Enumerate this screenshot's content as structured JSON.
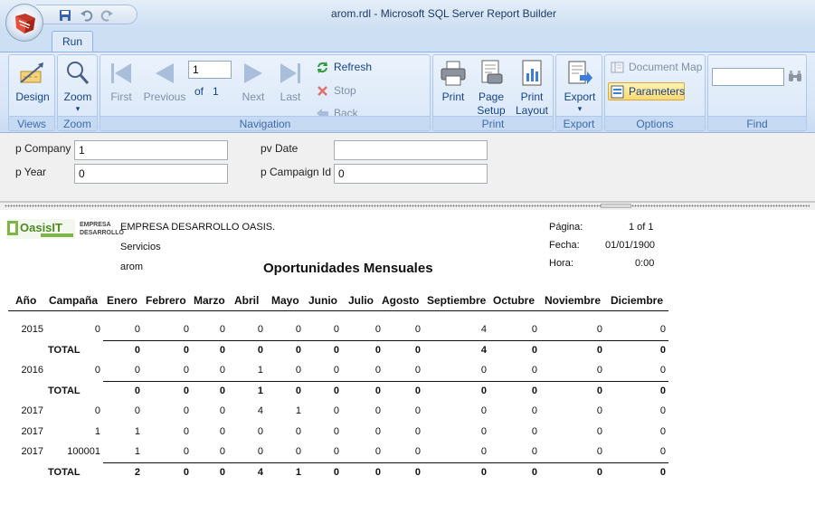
{
  "window": {
    "title": "arom.rdl - Microsoft SQL Server Report Builder"
  },
  "tabs": [
    {
      "label": "Run"
    }
  ],
  "ribbon": {
    "views": {
      "design_label": "Design",
      "group_label": "Views"
    },
    "zoom": {
      "zoom_label": "Zoom",
      "group_label": "Zoom"
    },
    "navigation": {
      "first_label": "First",
      "previous_label": "Previous",
      "page_value": "1",
      "of_label": "of",
      "total_pages": "1",
      "next_label": "Next",
      "last_label": "Last",
      "refresh_label": "Refresh",
      "stop_label": "Stop",
      "back_label": "Back",
      "group_label": "Navigation"
    },
    "print": {
      "print_label": "Print",
      "page_setup_label": "Page Setup",
      "print_layout_label": "Print Layout",
      "group_label": "Print"
    },
    "export": {
      "export_label": "Export",
      "group_label": "Export"
    },
    "options": {
      "document_map_label": "Document Map",
      "parameters_label": "Parameters",
      "group_label": "Options"
    },
    "find": {
      "search_value": "",
      "group_label": "Find"
    }
  },
  "parameters": {
    "p_company": {
      "label": "p Company",
      "value": "1"
    },
    "p_year": {
      "label": "p Year",
      "value": "0"
    },
    "pv_date": {
      "label": "pv Date",
      "value": ""
    },
    "p_campaign_id": {
      "label": "p Campaign Id",
      "value": "0"
    }
  },
  "report": {
    "logo_text": "OasisIT",
    "logo_sub": "EMPRESA DESARROLLO",
    "company": "EMPRESA DESARROLLO OASIS.",
    "department": "Servicios",
    "user": "arom",
    "title": "Oportunidades Mensuales",
    "meta": {
      "page_label": "Página:",
      "page_value": "1 of 1",
      "date_label": "Fecha:",
      "date_value": "01/01/1900",
      "time_label": "Hora:",
      "time_value": "0:00"
    },
    "columns": [
      "Año",
      "Campaña",
      "Enero",
      "Febrero",
      "Marzo",
      "Abril",
      "Mayo",
      "Junio",
      "Julio",
      "Agosto",
      "Septiembre",
      "Octubre",
      "Noviembre",
      "Diciembre"
    ],
    "rows": [
      {
        "type": "data",
        "cells": [
          "2015",
          "0",
          "0",
          "0",
          "0",
          "0",
          "0",
          "0",
          "0",
          "0",
          "4",
          "0",
          "0",
          "0"
        ]
      },
      {
        "type": "total",
        "cells": [
          "",
          "TOTAL",
          "0",
          "0",
          "0",
          "0",
          "0",
          "0",
          "0",
          "0",
          "4",
          "0",
          "0",
          "0"
        ]
      },
      {
        "type": "data",
        "cells": [
          "2016",
          "0",
          "0",
          "0",
          "0",
          "1",
          "0",
          "0",
          "0",
          "0",
          "0",
          "0",
          "0",
          "0"
        ]
      },
      {
        "type": "total",
        "cells": [
          "",
          "TOTAL",
          "0",
          "0",
          "0",
          "1",
          "0",
          "0",
          "0",
          "0",
          "0",
          "0",
          "0",
          "0"
        ]
      },
      {
        "type": "data",
        "cells": [
          "2017",
          "0",
          "0",
          "0",
          "0",
          "4",
          "1",
          "0",
          "0",
          "0",
          "0",
          "0",
          "0",
          "0"
        ]
      },
      {
        "type": "data",
        "cells": [
          "2017",
          "1",
          "1",
          "0",
          "0",
          "0",
          "0",
          "0",
          "0",
          "0",
          "0",
          "0",
          "0",
          "0"
        ]
      },
      {
        "type": "data",
        "cells": [
          "2017",
          "100001",
          "1",
          "0",
          "0",
          "0",
          "0",
          "0",
          "0",
          "0",
          "0",
          "0",
          "0",
          "0"
        ]
      },
      {
        "type": "total",
        "cells": [
          "",
          "TOTAL",
          "2",
          "0",
          "0",
          "4",
          "1",
          "0",
          "0",
          "0",
          "0",
          "0",
          "0",
          "0"
        ]
      }
    ]
  }
}
